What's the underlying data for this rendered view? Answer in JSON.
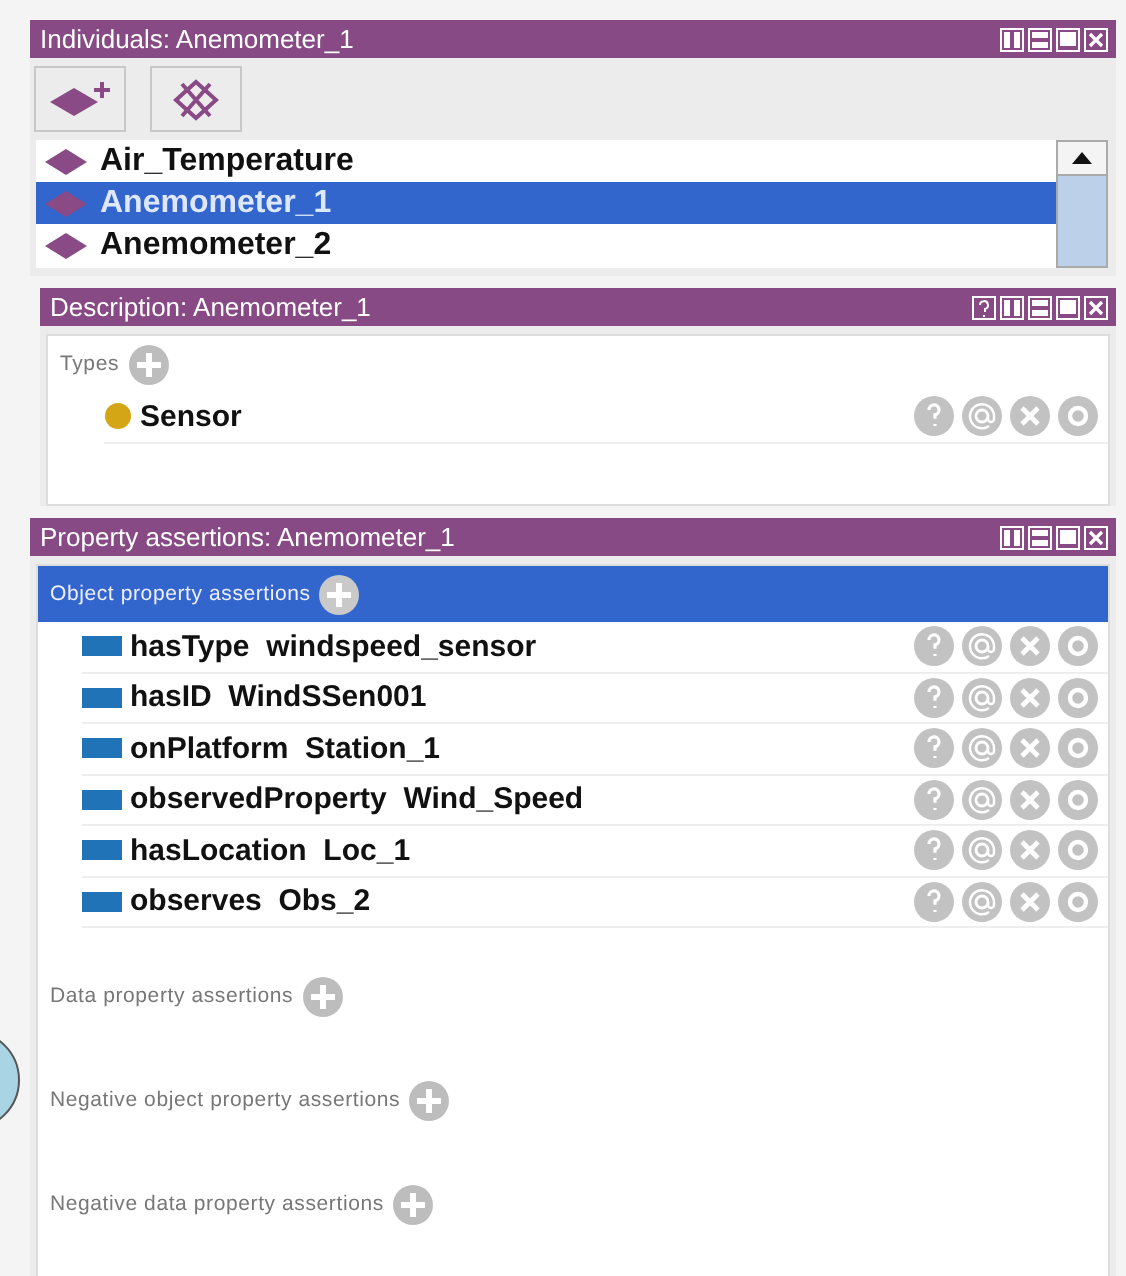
{
  "individuals": {
    "title": "Individuals: Anemometer_1",
    "items": [
      {
        "label": "Air_Temperature",
        "selected": false
      },
      {
        "label": "Anemometer_1",
        "selected": true
      },
      {
        "label": "Anemometer_2",
        "selected": false
      }
    ]
  },
  "description": {
    "title": "Description: Anemometer_1",
    "types_label": "Types",
    "types": [
      {
        "label": "Sensor"
      }
    ]
  },
  "property_assertions": {
    "title": "Property assertions: Anemometer_1",
    "sections": [
      {
        "label": "Object property assertions",
        "selected": true,
        "rows": [
          {
            "label": "hasType  windspeed_sensor"
          },
          {
            "label": "hasID  WindSSen001"
          },
          {
            "label": "onPlatform  Station_1"
          },
          {
            "label": "observedProperty  Wind_Speed"
          },
          {
            "label": "hasLocation  Loc_1"
          },
          {
            "label": "observes  Obs_2"
          }
        ]
      },
      {
        "label": "Data property assertions",
        "selected": false
      },
      {
        "label": "Negative object property assertions",
        "selected": false
      },
      {
        "label": "Negative data property assertions",
        "selected": false
      }
    ]
  }
}
